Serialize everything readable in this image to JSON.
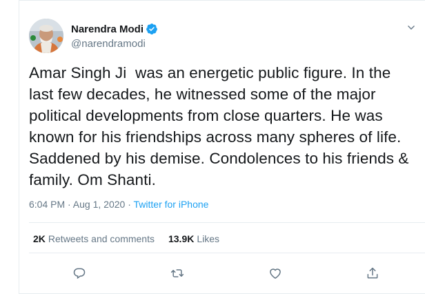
{
  "author": {
    "name": "Narendra Modi",
    "handle": "@narendramodi",
    "verified": true
  },
  "tweet": {
    "text": "Amar Singh Ji  was an energetic public figure. In the last few decades, he witnessed some of the major political developments from close quarters. He was known for his friendships across many spheres of life. Saddened by his demise. Condolences to his friends & family. Om Shanti."
  },
  "meta": {
    "time_date": "6:04 PM · Aug 1, 2020 · ",
    "source": "Twitter for iPhone"
  },
  "stats": {
    "retweets_count": "2K",
    "retweets_label": "Retweets and comments",
    "likes_count": "13.9K",
    "likes_label": "Likes"
  },
  "icons": {
    "reply": "reply-icon",
    "retweet": "retweet-icon",
    "like": "heart-icon",
    "share": "share-icon",
    "caret": "chevron-down-icon",
    "verified": "verified-badge-icon"
  },
  "colors": {
    "link": "#1da1f2",
    "secondary_text": "#657786",
    "primary_text": "#14171a",
    "divider": "#e6ecf0"
  }
}
